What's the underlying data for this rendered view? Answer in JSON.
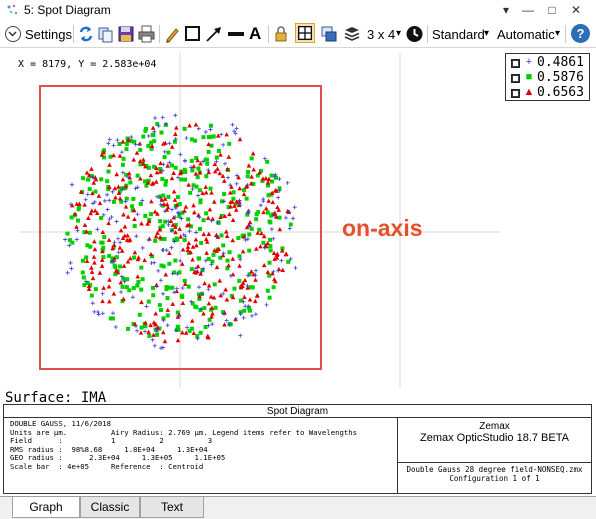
{
  "window": {
    "title": "5: Spot Diagram",
    "pin": "▾",
    "minimize": "—",
    "maximize": "□",
    "close": "✕"
  },
  "toolbar": {
    "settings_label": "Settings",
    "layout_label": "3 x 4",
    "standard_label": "Standard",
    "automatic_label": "Automatic",
    "help_label": "?",
    "text_tool_label": "A",
    "dropdown_arrow": "▾"
  },
  "plot": {
    "cursor_readout": "X = 8179, Y = 2.583e+04",
    "surface_label": "Surface: IMA",
    "annotation": "on-axis",
    "annotation_color": "#e8502a",
    "highlight_color": "#e05050",
    "legend": [
      {
        "marker": "+",
        "label": "0.4861",
        "color": "#3a3ad8"
      },
      {
        "marker": "■",
        "label": "0.5876",
        "color": "#00d000"
      },
      {
        "marker": "▲",
        "label": "0.6563",
        "color": "#e00000"
      }
    ]
  },
  "info": {
    "header": "Spot Diagram",
    "line1": "DOUBLE GAUSS, 11/6/2018",
    "line2": "Units are µm.          Airy Radius: 2.769 µm. Legend items refer to Wavelengths",
    "line3": "Field      :           1          2          3",
    "line4": "RMS radius :  98%8.68     1.8E+04     1.3E+04",
    "line5": "GEO radius :      2.3E+04     1.3E+05     1.1E+05",
    "line6": "Scale bar  : 4e+05     Reference  : Centroid",
    "brand": "Zemax",
    "product": "Zemax OpticStudio 18.7  BETA",
    "file": "Double Gauss 28 degree field-NONSEQ.zmx",
    "config": "Configuration 1 of 1"
  },
  "tabs": [
    {
      "label": "Graph",
      "active": true
    },
    {
      "label": "Classic",
      "active": false
    },
    {
      "label": "Text",
      "active": false
    }
  ]
}
